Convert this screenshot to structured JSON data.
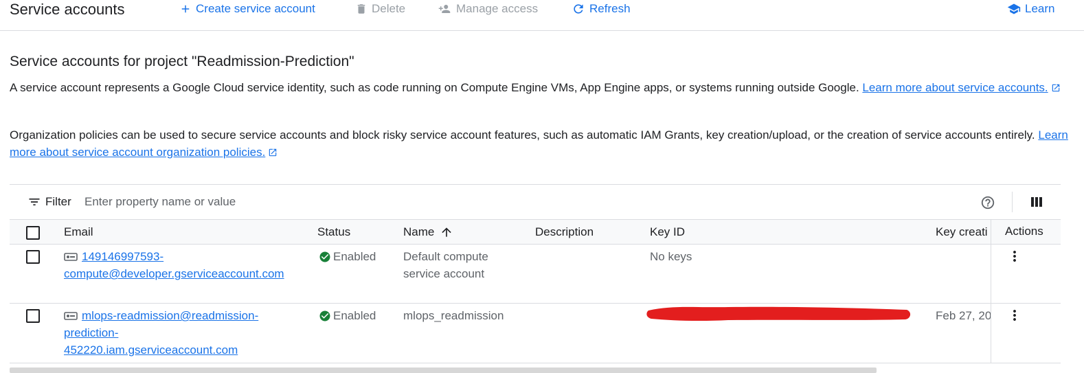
{
  "header": {
    "title": "Service accounts",
    "create_label": "Create service account",
    "delete_label": "Delete",
    "manage_label": "Manage access",
    "refresh_label": "Refresh",
    "learn_label": "Learn"
  },
  "intro": {
    "heading": "Service accounts for project \"Readmission-Prediction\"",
    "para1_text": "A service account represents a Google Cloud service identity, such as code running on Compute Engine VMs, App Engine apps, or systems running outside Google. ",
    "para1_link": "Learn more about service accounts.",
    "para2_text": "Organization policies can be used to secure service accounts and block risky service account features, such as automatic IAM Grants, key creation/upload, or the creation of service accounts entirely. ",
    "para2_link": "Learn more about service account organization policies."
  },
  "filter": {
    "label": "Filter",
    "placeholder": "Enter property name or value"
  },
  "table": {
    "columns": {
      "email": "Email",
      "status": "Status",
      "name": "Name",
      "description": "Description",
      "key_id": "Key ID",
      "key_creation": "Key creati",
      "actions": "Actions"
    },
    "rows": [
      {
        "email_line1": "149146997593-",
        "email_line2": "compute@developer.gserviceaccount.com",
        "email_line3": "",
        "status": "Enabled",
        "name_line1": "Default compute",
        "name_line2": "service account",
        "description": "",
        "key_id": "No keys",
        "key_creation": ""
      },
      {
        "email_line1": "mlops-readmission@readmission-",
        "email_line2": "prediction-",
        "email_line3": "452220.iam.gserviceaccount.com",
        "status": "Enabled",
        "name_line1": "mlops_readmission",
        "name_line2": "",
        "description": "",
        "key_id": "",
        "key_creation": "Feb 27, 20"
      }
    ]
  },
  "colors": {
    "accent": "#1a73e8",
    "enabled_green": "#188038",
    "redaction": "#e31e1e"
  },
  "icons": [
    "plus-icon",
    "trash-icon",
    "person-add-icon",
    "refresh-icon",
    "school-icon",
    "filter-list-icon",
    "help-icon",
    "column-view-icon",
    "arrow-up-icon",
    "key-icon",
    "check-circle-icon",
    "more-vert-icon",
    "open-in-new-icon"
  ]
}
